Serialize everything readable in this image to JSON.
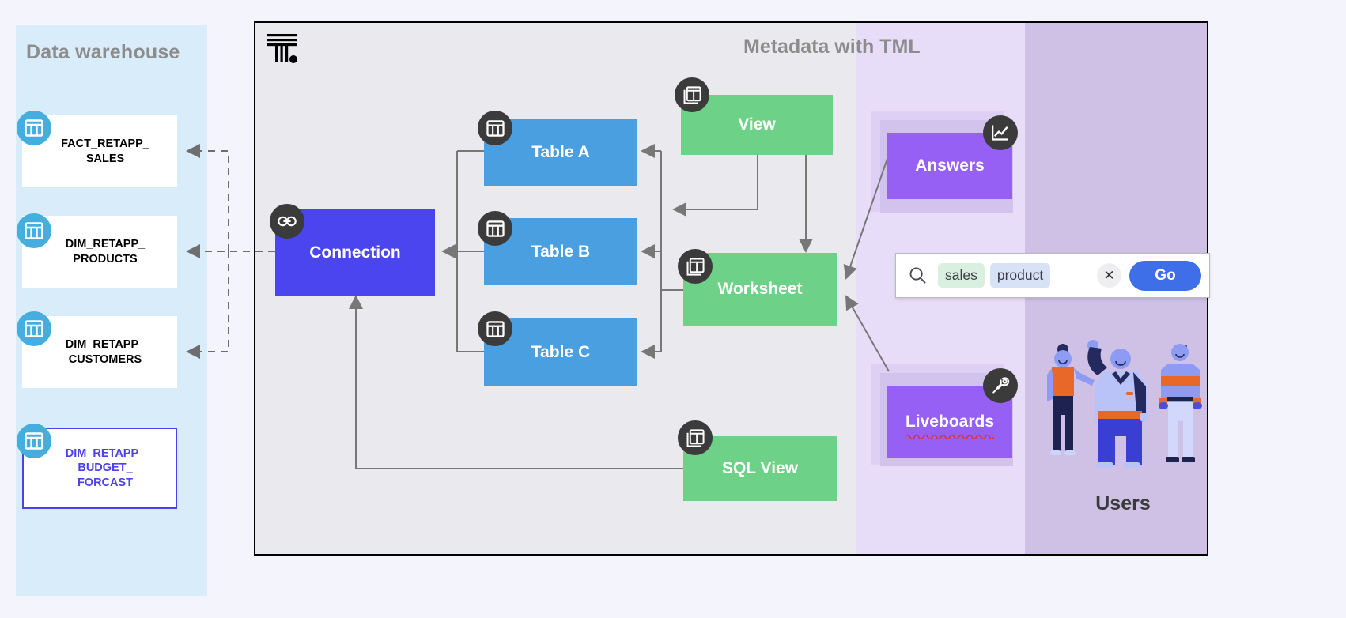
{
  "warehouse": {
    "title": "Data warehouse",
    "tables": [
      {
        "name": "FACT_RETAPP_\nSALES",
        "highlight": false,
        "icon": "table-icon"
      },
      {
        "name": "DIM_RETAPP_\nPRODUCTS",
        "highlight": false,
        "icon": "table-icon"
      },
      {
        "name": "DIM_RETAPP_\nCUSTOMERS",
        "highlight": false,
        "icon": "table-icon"
      },
      {
        "name": "DIM_RETAPP_\nBUDGET_\nFORCAST",
        "highlight": true,
        "icon": "table-icon"
      }
    ]
  },
  "metadata": {
    "title": "Metadata with TML",
    "logo": "thoughtspot-logo",
    "nodes": {
      "connection": {
        "label": "Connection",
        "icon": "link-icon",
        "color": "#4a45ef"
      },
      "table_a": {
        "label": "Table A",
        "icon": "table-icon",
        "color": "#4a9fe0"
      },
      "table_b": {
        "label": "Table B",
        "icon": "table-icon",
        "color": "#4a9fe0"
      },
      "table_c": {
        "label": "Table C",
        "icon": "table-icon",
        "color": "#4a9fe0"
      },
      "view": {
        "label": "View",
        "icon": "view-icon",
        "color": "#6ed188"
      },
      "worksheet": {
        "label": "Worksheet",
        "icon": "view-icon",
        "color": "#6ed188"
      },
      "sql_view": {
        "label": "SQL View",
        "icon": "view-icon",
        "color": "#6ed188"
      }
    }
  },
  "consumption": {
    "answers": {
      "label": "Answers",
      "icon": "chart-icon",
      "color": "#9760f4"
    },
    "liveboards": {
      "label": "Liveboards",
      "icon": "pin-icon",
      "color": "#9760f4",
      "spellcheck_underline": true
    }
  },
  "search": {
    "search_icon": "search-icon",
    "tokens": [
      {
        "text": "sales",
        "color": "#d9f0e0"
      },
      {
        "text": "product",
        "color": "#d7e2f7"
      }
    ],
    "clear_label": "✕",
    "go_label": "Go"
  },
  "users": {
    "label": "Users",
    "illustration": "three-people-illustration"
  },
  "colors": {
    "warehouse_panel": "#d9ecfa",
    "metadata_panel": "#eaeaee",
    "shade_light_purple": "#e8ddf9",
    "shade_purple": "#cfc0e6",
    "page_background": "#f4f4fd",
    "badge": "#3c3b3b",
    "table_icon_circle": "#45aede"
  }
}
